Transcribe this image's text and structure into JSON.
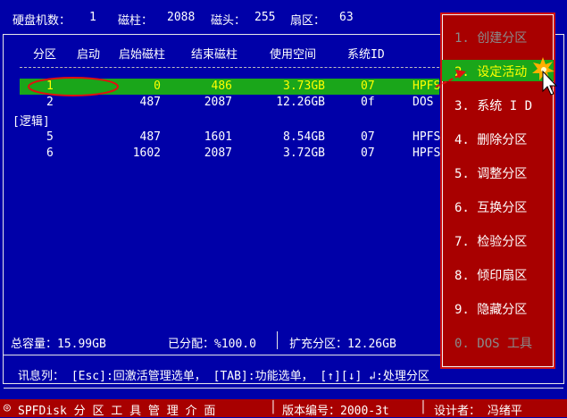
{
  "header": {
    "disk_label": "硬盘机数：",
    "disk_value": "1",
    "cyl_label": "磁柱：",
    "cyl_value": "2088",
    "heads_label": "磁头：",
    "heads_value": "255",
    "sectors_label": "扇区：",
    "sectors_value": "63"
  },
  "table": {
    "columns": [
      "分区",
      "启动",
      "启始磁柱",
      "结束磁柱",
      "使用空间",
      "系统ID"
    ],
    "rows": [
      {
        "part": "1",
        "start": "0",
        "begin": "486",
        "size": "3.73GB",
        "id": "07",
        "fs": "HPFS",
        "selected": true
      },
      {
        "part": "2",
        "start": "487",
        "begin": "2087",
        "size": "12.26GB",
        "id": "0f",
        "fs": "DOS",
        "selected": false
      }
    ],
    "logical_label": "[逻辑]",
    "logical_rows": [
      {
        "part": "5",
        "start": "487",
        "begin": "1601",
        "size": "8.54GB",
        "id": "07",
        "fs": "HPFS"
      },
      {
        "part": "6",
        "start": "1602",
        "begin": "2087",
        "size": "3.72GB",
        "id": "07",
        "fs": "HPFS"
      }
    ]
  },
  "summary": {
    "total": "总容量：15.99GB",
    "allocated": "已分配：%100.0",
    "extended": "扩充分区：12.26GB"
  },
  "message": "讯息列：  [Esc]:回激活管理选单，  [TAB]:功能选单，  [↑][↓] ↲:处理分区",
  "menu": [
    {
      "label": "1. 创建分区",
      "state": "dim"
    },
    {
      "label": "2. 设定活动",
      "state": "highlight"
    },
    {
      "label": "3. 系统 I D",
      "state": "normal"
    },
    {
      "label": "4. 删除分区",
      "state": "normal"
    },
    {
      "label": "5. 调整分区",
      "state": "normal"
    },
    {
      "label": "6. 互换分区",
      "state": "normal"
    },
    {
      "label": "7. 检验分区",
      "state": "normal"
    },
    {
      "label": "8. 倾印扇区",
      "state": "normal"
    },
    {
      "label": "9. 隐藏分区",
      "state": "normal"
    },
    {
      "label": "0. DOS 工具",
      "state": "dim"
    }
  ],
  "statusbar": {
    "title": "SPFDisk 分 区 工 具 管 理 介 面",
    "version": "版本编号：2000-3t",
    "author": "设计者： 冯绪平"
  },
  "colors": {
    "background": "#0000a8",
    "menu": "#a80000",
    "highlight": "#1aa61a",
    "annotation": "#e01010"
  }
}
